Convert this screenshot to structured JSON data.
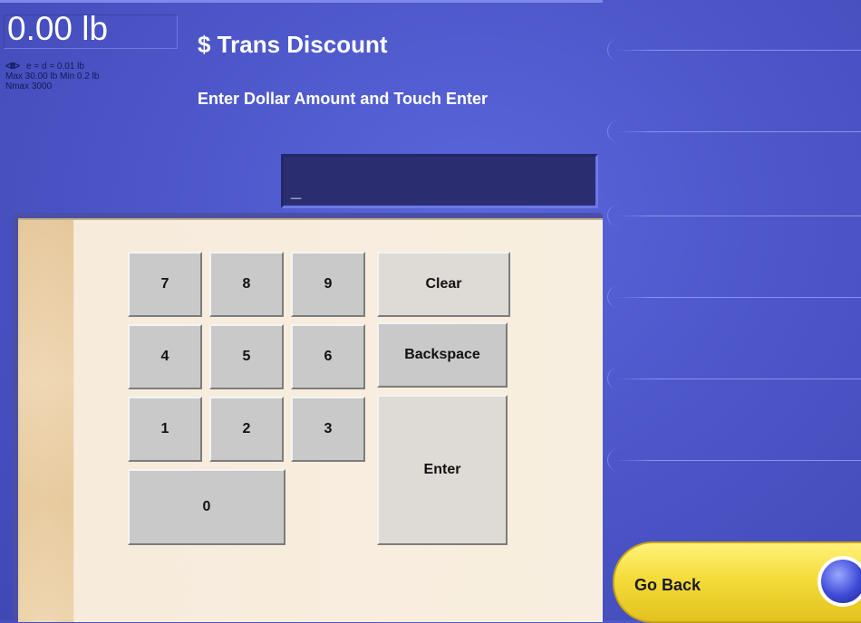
{
  "scale": {
    "weight": "0.00 lb",
    "info_line1": "e = d = 0.01 lb",
    "info_line2": "Max 30.00 lb Min 0.2 lb",
    "info_line3": "Nmax 3000"
  },
  "header": {
    "title": "$ Trans Discount",
    "instruction": "Enter Dollar Amount and Touch Enter"
  },
  "entry": {
    "value": "_"
  },
  "keypad": {
    "k7": "7",
    "k8": "8",
    "k9": "9",
    "k4": "4",
    "k5": "5",
    "k6": "6",
    "k1": "1",
    "k2": "2",
    "k3": "3",
    "k0": "0",
    "clear": "Clear",
    "backspace": "Backspace",
    "enter": "Enter"
  },
  "footer": {
    "go_back": "Go Back"
  },
  "colors": {
    "background": "#4d57c9",
    "panel": "#f8eedf",
    "key": "#c9c9c9",
    "go_back": "#f5dc3a",
    "knob": "#3e4ad6"
  }
}
